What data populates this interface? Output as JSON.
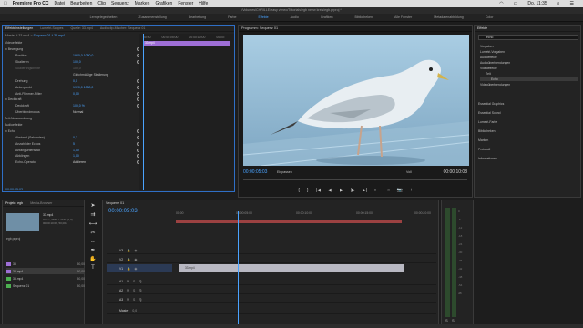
{
  "menubar": {
    "app": "Premiere Pro CC",
    "items": [
      "Datei",
      "Bearbeiten",
      "Clip",
      "Sequenz",
      "Marken",
      "Grafiken",
      "Fenster",
      "Hilfe"
    ],
    "clock": "Do. 11:35"
  },
  "titlebar": "/Volumes/CHRILLE/easy vimeo/Tutorials/egb neew kreis/egb.prproj *",
  "workspaces": {
    "items": [
      "Lerngelegenheiten",
      "Zusammenstellung",
      "Bearbeitung",
      "Farbe",
      "Effekte",
      "Audio",
      "Grafiken",
      "Bibliotheken",
      "Alle Fenster",
      "Metadatenabbildung",
      "Color"
    ],
    "active_index": 4
  },
  "effect_controls": {
    "tabs": [
      "Effekteinstellungen",
      "Lumetri-Scopes",
      "Quelle: 33.mp4",
      "Audioclip-Mischer: Sequenz 01"
    ],
    "master_label": "Master * 33.mp4",
    "sequence_label": "Sequenz 01 * 33.mp4",
    "ruler": [
      "00:00",
      "00:00:05:00",
      "00:00:10:00",
      "00:00:"
    ],
    "clip_label": "33.mp4",
    "rows": [
      {
        "label": "Videoeffekte",
        "value": ""
      },
      {
        "label": "fx  Bewegung",
        "value": ""
      },
      {
        "label": "Position",
        "value": "1920,0   1080,0"
      },
      {
        "label": "Skalieren",
        "value": "100,0"
      },
      {
        "label": "Skalierungsbreite",
        "value": "100,0"
      },
      {
        "label": "",
        "value": "Gleichmäßige Skalierung"
      },
      {
        "label": "Drehung",
        "value": "0,0"
      },
      {
        "label": "Ankerpunkt",
        "value": "1920,0   1080,0"
      },
      {
        "label": "Anti-Flimmer-Filter",
        "value": "0,00"
      },
      {
        "label": "fx  Deckkraft",
        "value": ""
      },
      {
        "label": "Deckkraft",
        "value": "100,0 %"
      },
      {
        "label": "Überblendmodus",
        "value": "Normal"
      },
      {
        "label": "Zeit-Neuzuordnung",
        "value": ""
      },
      {
        "label": "Audioeffekte",
        "value": ""
      },
      {
        "label": "fx  Echo",
        "value": ""
      },
      {
        "label": "Abstand (Sekunden)",
        "value": "0,7"
      },
      {
        "label": "Anzahl der Echos",
        "value": "5"
      },
      {
        "label": "Anfangsintensität",
        "value": "1,00"
      },
      {
        "label": "Abklingen",
        "value": "1,00"
      },
      {
        "label": "Echo-Operator",
        "value": "Addieren"
      }
    ],
    "time": "00:00:05:03"
  },
  "program_monitor": {
    "title": "Programm: Sequenz 01",
    "tc_left": "00:00:05:03",
    "fit": "Einpassen",
    "quality": "Voll",
    "tc_right": "00:00:10:08",
    "controls": [
      "{",
      "}",
      "|◀",
      "◀|",
      "▶",
      "|▶",
      "▶|",
      "⇤",
      "⇥",
      "📷",
      "+"
    ]
  },
  "effects_panel": {
    "title": "Effekte",
    "search": "echo",
    "items": [
      "Vorgaben",
      "Lumetri-Vorgaben",
      "Audioeffekte",
      "Audioüberblendungen",
      "Videoeffekte",
      "Zeit",
      "Echo",
      "Videoüberblendungen"
    ],
    "selected": "Echo",
    "sections": [
      "Essential Graphics",
      "Essential Sound",
      "Lumetri-Farbe",
      "Bibliotheken",
      "Marken",
      "Protokoll",
      "Informationen"
    ]
  },
  "project": {
    "tabs": [
      "Projekt: egb",
      "Media-Browser"
    ],
    "clip_name": "33.mp4",
    "clip_info": "Video, 3840 x 2160 (1,0)",
    "clip_info2": "00:00:10:08, 50,00p",
    "path": "egb.prproj",
    "rows": [
      {
        "name": "33",
        "fps": "50,00",
        "color": "#9e6fd6"
      },
      {
        "name": "33.mp4",
        "fps": "50,00",
        "color": "#9e6fd6"
      },
      {
        "name": "33.mp4",
        "fps": "50,00",
        "color": "#4caf50"
      },
      {
        "name": "Sequenz 01",
        "fps": "50,00",
        "color": "#4caf50"
      }
    ],
    "selected_index": 1
  },
  "timeline": {
    "tab": "Sequenz 01",
    "time": "00:00:05:03",
    "ruler": [
      "00:00",
      "00:00:05:00",
      "00:00:10:00",
      "00:00:15:00",
      "00:00:20:00"
    ],
    "tracks": [
      "V3",
      "V2",
      "V1",
      "A1",
      "A2",
      "A3",
      "Master"
    ],
    "v1_clip": "33.mp4",
    "master_level": "0,0"
  }
}
